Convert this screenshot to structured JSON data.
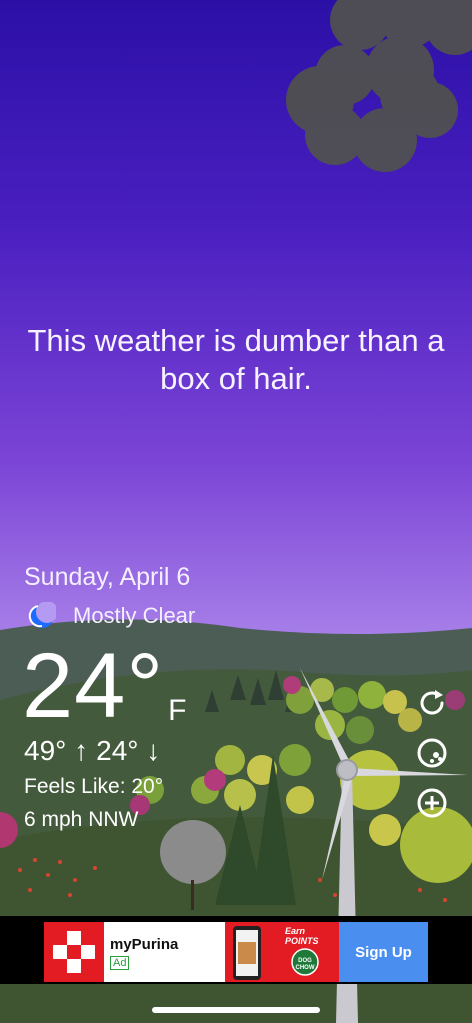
{
  "quote": "This weather is dumber than a box of hair.",
  "date": "Sunday, April 6",
  "condition": {
    "icon": "moon-icon",
    "text": "Mostly Clear"
  },
  "temperature": {
    "value": "24°",
    "unit": "F"
  },
  "high_low": {
    "high": "49° ↑",
    "low": "24° ↓"
  },
  "feels_like": "Feels Like: 20°",
  "wind": "6 mph NNW",
  "side_buttons": [
    "refresh-icon",
    "theme-icon",
    "add-icon"
  ],
  "ad": {
    "brand": "myPurina",
    "badge": "Ad",
    "promo_headline": "Earn POINTS",
    "promo_seal": "DOG CHOW",
    "cta": "Sign Up"
  },
  "colors": {
    "sky_top": "#2b10a6",
    "sky_bottom": "#b79cf0",
    "hills": "#3f5a3c",
    "ad_red": "#e31b23",
    "cta_blue": "#4a8ef0"
  }
}
